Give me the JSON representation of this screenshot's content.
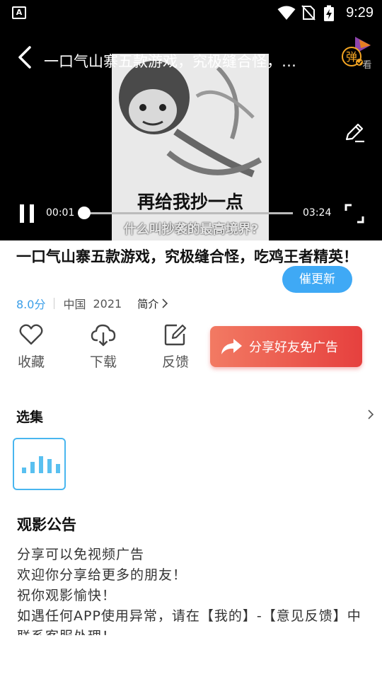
{
  "status_bar": {
    "time": "9:29",
    "badge": "A",
    "icons": [
      "notification-icon",
      "wifi-icon",
      "no-sim-icon",
      "battery-charging-icon"
    ]
  },
  "player": {
    "title": "一口气山寨五款游戏，究极缝合怪，吃鸡王者精英！",
    "caption_main": "再给我抄一点",
    "caption_sub": "什么叫抄袭的最高境界?",
    "current_time": "00:01",
    "duration": "03:24",
    "progress": 0.005,
    "danmu_label": "弹",
    "danmu_sub": "看",
    "icons": [
      "back-icon",
      "danmu-icon",
      "edit-icon",
      "pause-icon",
      "fullscreen-icon"
    ]
  },
  "info": {
    "title": "一口气山寨五款游戏，究极缝合怪，吃鸡王者精英！",
    "urge_button": "催更新",
    "score": "8.0分",
    "region": "中国",
    "year": "2021",
    "intro_label": "简介"
  },
  "actions": [
    {
      "label": "收藏",
      "icon": "heart-icon"
    },
    {
      "label": "下载",
      "icon": "cloud-download-icon"
    },
    {
      "label": "反馈",
      "icon": "feedback-edit-icon"
    }
  ],
  "share_button": {
    "label": "分享好友免广告",
    "icon": "share-arrow-icon"
  },
  "episodes": {
    "section_title": "选集",
    "playing_indicator": "equalizer-icon"
  },
  "notice": {
    "title": "观影公告",
    "lines": [
      "分享可以免视频广告",
      "欢迎你分享给更多的朋友！",
      "祝你观影愉快！",
      "如遇任何APP使用异常，请在【我的】-【意见反馈】中联系客服处理！"
    ]
  },
  "colors": {
    "accent_blue": "#3fa9f5",
    "score_blue": "#3a9ee8",
    "share_red": "#e6403e",
    "episode_border": "#49b6ef"
  }
}
